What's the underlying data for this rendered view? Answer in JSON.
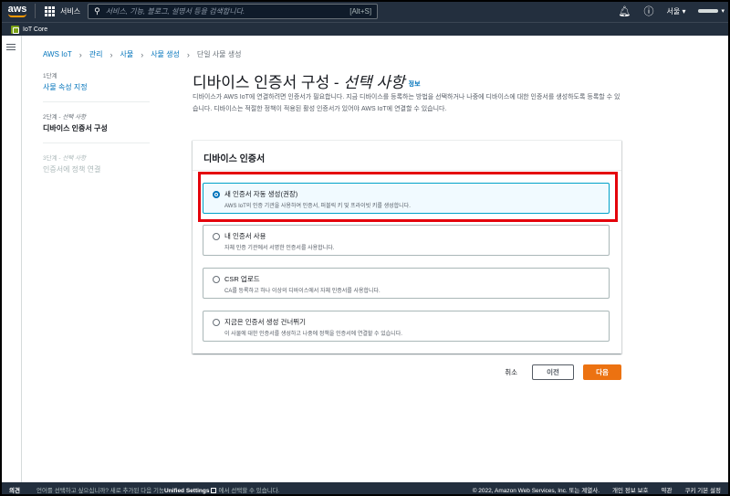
{
  "topnav": {
    "logo": "aws",
    "services_label": "서비스",
    "search_placeholder": "서비스, 기능, 블로그, 설명서 등을 검색합니다.",
    "search_shortcut": "[Alt+S]",
    "region": "서울 ▾"
  },
  "subbar": {
    "service_name": "IoT Core"
  },
  "breadcrumb": [
    "AWS IoT",
    "관리",
    "사물",
    "사물 생성",
    "단일 사물 생성"
  ],
  "steps": [
    {
      "step": "1단계",
      "optional": "",
      "name": "사물 속성 지정"
    },
    {
      "step": "2단계 - ",
      "optional": "선택 사항",
      "name": "디바이스 인증서 구성"
    },
    {
      "step": "3단계 - ",
      "optional": "선택 사항",
      "name": "인증서에 정책 연결"
    }
  ],
  "page": {
    "title_main": "디바이스 인증서 구성 - ",
    "title_optional": "선택 사항",
    "info_link": "정보",
    "description": "디바이스가 AWS IoT에 연결하려면 인증서가 필요합니다. 지금 디바이스를 등록하는 방법을 선택하거나 나중에 디바이스에 대한 인증서를 생성하도록 등록할 수 있습니다. 디바이스는 적절한 정책이 적용된 활성 인증서가 있어야 AWS IoT에 연결할 수 있습니다."
  },
  "panel": {
    "header": "디바이스 인증서",
    "options": [
      {
        "title": "새 인증서 자동 생성(권장)",
        "desc": "AWS IoT의 인증 기관을 사용하여 인증서, 퍼블릭 키 및 프라이빗 키를 생성합니다.",
        "selected": true
      },
      {
        "title": "내 인증서 사용",
        "desc": "자체 인증 기관에서 서명한 인증서를 사용합니다.",
        "selected": false
      },
      {
        "title": "CSR 업로드",
        "desc": "CA를 등록하고 하나 이상의 디바이스에서 자체 인증서를 사용합니다.",
        "selected": false
      },
      {
        "title": "지금은 인증서 생성 건너뛰기",
        "desc": "이 사물에 대한 인증서를 생성하고 나중에 정책을 인증서에 연결할 수 있습니다.",
        "selected": false
      }
    ]
  },
  "actions": {
    "cancel": "취소",
    "previous": "이전",
    "next": "다음"
  },
  "footer": {
    "feedback": "의견",
    "msg_prefix": "언어를 선택하고 싶으십니까? 새로 추가된 다음 기능",
    "msg_link": "Unified Settings",
    "msg_suffix": "에서 선택할 수 있습니다.",
    "copyright": "© 2022, Amazon Web Services, Inc. 또는 계열사.",
    "privacy": "개인 정보 보호",
    "terms": "약관",
    "cookies": "쿠키 기본 설정"
  },
  "colors": {
    "nav_bg": "#232f3e",
    "link": "#0073bb",
    "primary": "#ec7211",
    "highlight": "#e4000b"
  }
}
